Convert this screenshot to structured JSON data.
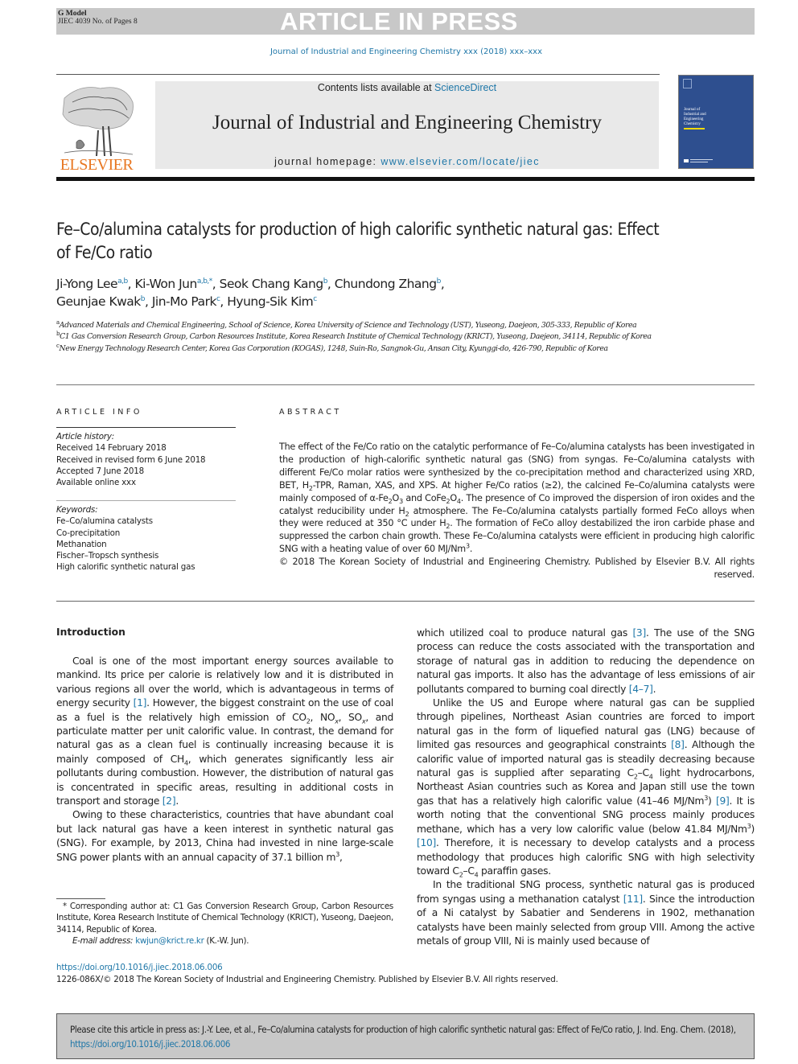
{
  "banner": {
    "model": "G Model",
    "manuscript": "JIEC 4039 No. of Pages 8",
    "status": "ARTICLE IN PRESS"
  },
  "running_citation": "Journal of Industrial and Engineering Chemistry xxx (2018) xxx–xxx",
  "masthead": {
    "contents_prefix": "Contents lists available at ",
    "sciencedirect": "ScienceDirect",
    "journal_title": "Journal of Industrial and Engineering Chemistry",
    "homepage_prefix": "journal homepage: ",
    "homepage_url": "www.elsevier.com/locate/jiec",
    "publisher": "ELSEVIER",
    "cover_title": [
      "Journal of",
      "Industrial and",
      "Engineering",
      "Chemistry"
    ]
  },
  "article": {
    "title": "Fe–Co/alumina catalysts for production of high calorific synthetic natural gas: Effect of Fe/Co ratio",
    "authors": [
      {
        "name": "Ji-Yong Lee",
        "aff": "a,b"
      },
      {
        "name": "Ki-Won Jun",
        "aff": "a,b,*"
      },
      {
        "name": "Seok Chang Kang",
        "aff": "b"
      },
      {
        "name": "Chundong Zhang",
        "aff": "b"
      },
      {
        "name": "Geunjae Kwak",
        "aff": "b"
      },
      {
        "name": "Jin-Mo Park",
        "aff": "c"
      },
      {
        "name": "Hyung-Sik Kim",
        "aff": "c"
      }
    ],
    "affiliations": [
      {
        "key": "a",
        "text": "Advanced Materials and Chemical Engineering, School of Science, Korea University of Science and Technology (UST), Yuseong, Daejeon, 305-333, Republic of Korea"
      },
      {
        "key": "b",
        "text": "C1 Gas Conversion Research Group, Carbon Resources Institute, Korea Research Institute of Chemical Technology (KRICT), Yuseong, Daejeon, 34114, Republic of Korea"
      },
      {
        "key": "c",
        "text": "New Energy Technology Research Center, Korea Gas Corporation (KOGAS), 1248, Suin-Ro, Sangnok-Gu, Ansan City, Kyunggi-do, 426-790, Republic of Korea"
      }
    ]
  },
  "article_info": {
    "label": "ARTICLE INFO",
    "history_label": "Article history:",
    "history": [
      "Received 14 February 2018",
      "Received in revised form 6 June 2018",
      "Accepted 7 June 2018",
      "Available online xxx"
    ],
    "keywords_label": "Keywords:",
    "keywords": [
      "Fe–Co/alumina catalysts",
      "Co-precipitation",
      "Methanation",
      "Fischer–Tropsch synthesis",
      "High calorific synthetic natural gas"
    ]
  },
  "abstract": {
    "label": "ABSTRACT",
    "s1": "The effect of the Fe/Co ratio on the catalytic performance of Fe–Co/alumina catalysts has been investigated in the production of high-calorific synthetic natural gas (SNG) from syngas. Fe–Co/alumina catalysts with different Fe/Co molar ratios were synthesized by the co-precipitation method and characterized using XRD, BET, H",
    "s2": "-TPR, Raman, XAS, and XPS. At higher Fe/Co ratios (≥2), the calcined Fe–Co/alumina catalysts were mainly composed of α-Fe",
    "s3": "O",
    "s4": " and CoFe",
    "s5": "O",
    "s6": ". The presence of Co improved the dispersion of iron oxides and the catalyst reducibility under H",
    "s7": " atmosphere. The Fe–Co/alumina catalysts partially formed FeCo alloys when they were reduced at 350 °C under H",
    "s8": ". The formation of FeCo alloy destabilized the iron carbide phase and suppressed the carbon chain growth. These Fe–Co/alumina catalysts were efficient in producing high calorific SNG with a heating value of over 60 MJ/Nm",
    "s9": ".",
    "copyright": "© 2018 The Korean Society of Industrial and Engineering Chemistry. Published by Elsevier B.V. All rights reserved."
  },
  "body": {
    "intro_heading": "Introduction",
    "p1": {
      "a": "Coal is one of the most important energy sources available to mankind. Its price per calorie is relatively low and it is distributed in various regions all over the world, which is advantageous in terms of energy security ",
      "ref1": "[1]",
      "b": ". However, the biggest constraint on the use of coal as a fuel is the relatively high emission of CO",
      "c": ", NO",
      "d": ", SO",
      "e": ", and particulate matter per unit calorific value. In contrast, the demand for natural gas as a clean fuel is continually increasing because it is mainly composed of CH",
      "f": ", which generates significantly less air pollutants during combustion. However, the distribution of natural gas is concentrated in specific areas, resulting in additional costs in transport and storage ",
      "ref2": "[2]",
      "g": "."
    },
    "p2": {
      "a": "Owing to these characteristics, countries that have abundant coal but lack natural gas have a keen interest in synthetic natural gas (SNG). For example, by 2013, China had invested in nine large-scale SNG power plants with an annual capacity of 37.1 billion m",
      "b": ", which utilized coal to produce natural gas ",
      "ref3": "[3]",
      "c": ". The use of the SNG process can reduce the costs associated with the transportation and storage of natural gas in addition to reducing the dependence on natural gas imports. It also has the advantage of less emissions of air pollutants compared to burning coal directly ",
      "ref4": "[4–7]",
      "d": "."
    },
    "p3": {
      "a": "Unlike the US and Europe where natural gas can be supplied through pipelines, Northeast Asian countries are forced to import natural gas in the form of liquefied natural gas (LNG) because of limited gas resources and geographical constraints ",
      "ref8": "[8]",
      "b": ". Although the calorific value of imported natural gas is steadily decreasing because natural gas is supplied after separating C",
      "c": "–C",
      "d": " light hydrocarbons, Northeast Asian countries such as Korea and Japan still use the town gas that has a relatively high calorific value (41–46 MJ/Nm",
      "e": ") ",
      "ref9": "[9]",
      "f": ". It is worth noting that the conventional SNG process mainly produces methane, which has a very low calorific value (below 41.84 MJ/Nm",
      "g": ") ",
      "ref10": "[10]",
      "h": ". Therefore, it is necessary to develop catalysts and a process methodology that produces high calorific SNG with high selectivity toward C",
      "i": "–C",
      "j": " paraffin gases."
    },
    "p4": {
      "a": "In the traditional SNG process, synthetic natural gas is produced from syngas using a methanation catalyst ",
      "ref11": "[11]",
      "b": ". Since the introduction of a Ni catalyst by Sabatier and Senderens in 1902, methanation catalysts have been mainly selected from group VIII. Among the active metals of group VIII, Ni is mainly used because of"
    },
    "sub": {
      "two": "2",
      "three": "3",
      "four": "4",
      "x": "x"
    }
  },
  "footnote": {
    "star": "*",
    "text": " Corresponding author at: C1 Gas Conversion Research Group, Carbon Resources Institute, Korea Research Institute of Chemical Technology (KRICT), Yuseong, Daejeon, 34114, Republic of Korea.",
    "email_label": "E-mail address: ",
    "email": "kwjun@krict.re.kr",
    "email_suffix": " (K.-W. Jun)."
  },
  "doi": "https://doi.org/10.1016/j.jiec.2018.06.006",
  "issn_line": "1226-086X/© 2018 The Korean Society of Industrial and Engineering Chemistry. Published by Elsevier B.V. All rights reserved.",
  "cite_box": {
    "text": "Please cite this article in press as: J.-Y. Lee, et al., Fe–Co/alumina catalysts for production of high calorific synthetic natural gas: Effect of Fe/Co ratio, J. Ind. Eng. Chem. (2018), ",
    "link": "https://doi.org/10.1016/j.jiec.2018.06.006"
  },
  "colors": {
    "link": "#1f77a8",
    "banner_gray": "#c8c8c8",
    "masthead_gray": "#e9e9e9",
    "elsevier_orange": "#e87722",
    "cover_blue": "#2e4f8f"
  }
}
